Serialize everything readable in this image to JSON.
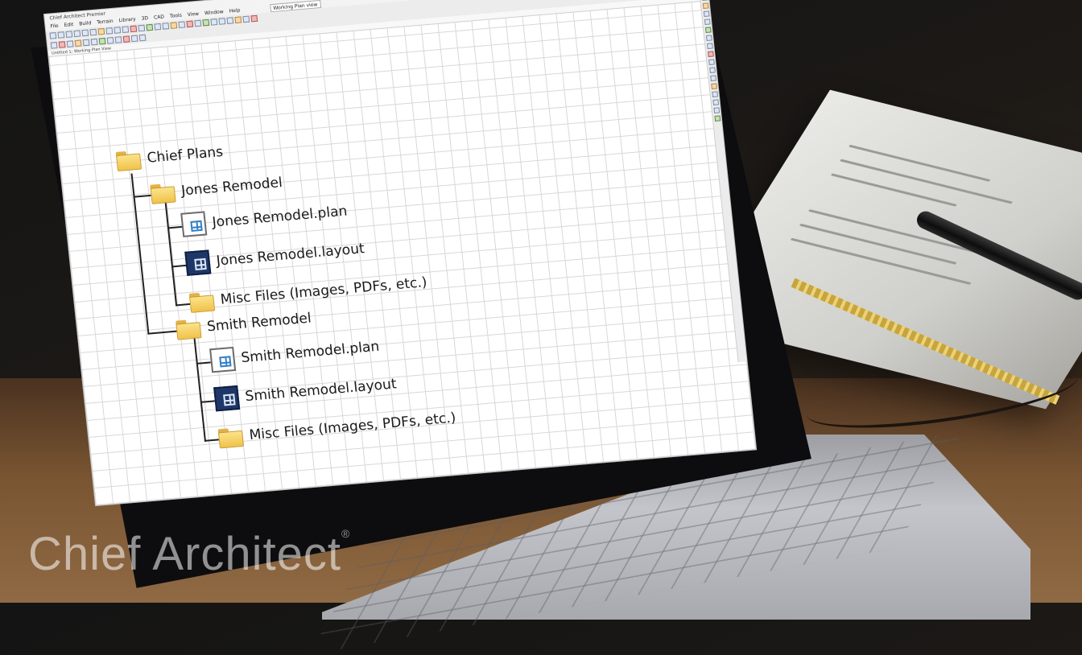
{
  "window": {
    "title": "Chief Architect Premier",
    "tab": "Untitled 1: Working Plan View",
    "plan_view_field": "Working Plan view"
  },
  "menu": [
    "File",
    "Edit",
    "Build",
    "Terrain",
    "Library",
    "3D",
    "CAD",
    "Tools",
    "View",
    "Window",
    "Help"
  ],
  "tree": {
    "root": "Chief Plans",
    "projects": [
      {
        "name": "Jones Remodel",
        "items": [
          {
            "label": "Jones Remodel.plan",
            "icon": "plan-file-icon"
          },
          {
            "label": "Jones Remodel.layout",
            "icon": "layout-file-icon"
          },
          {
            "label": "Misc Files (Images, PDFs, etc.)",
            "icon": "folder-icon"
          }
        ]
      },
      {
        "name": "Smith Remodel",
        "items": [
          {
            "label": "Smith Remodel.plan",
            "icon": "plan-file-icon"
          },
          {
            "label": "Smith Remodel.layout",
            "icon": "layout-file-icon"
          },
          {
            "label": "Misc Files (Images, PDFs, etc.)",
            "icon": "folder-icon"
          }
        ]
      }
    ]
  },
  "watermark": "Chief Architect",
  "colors": {
    "folder": "#f0c24a",
    "plan_icon_accent": "#2f7ec9",
    "layout_icon_bg": "#1f3768",
    "grid": "#d7d7d7"
  }
}
